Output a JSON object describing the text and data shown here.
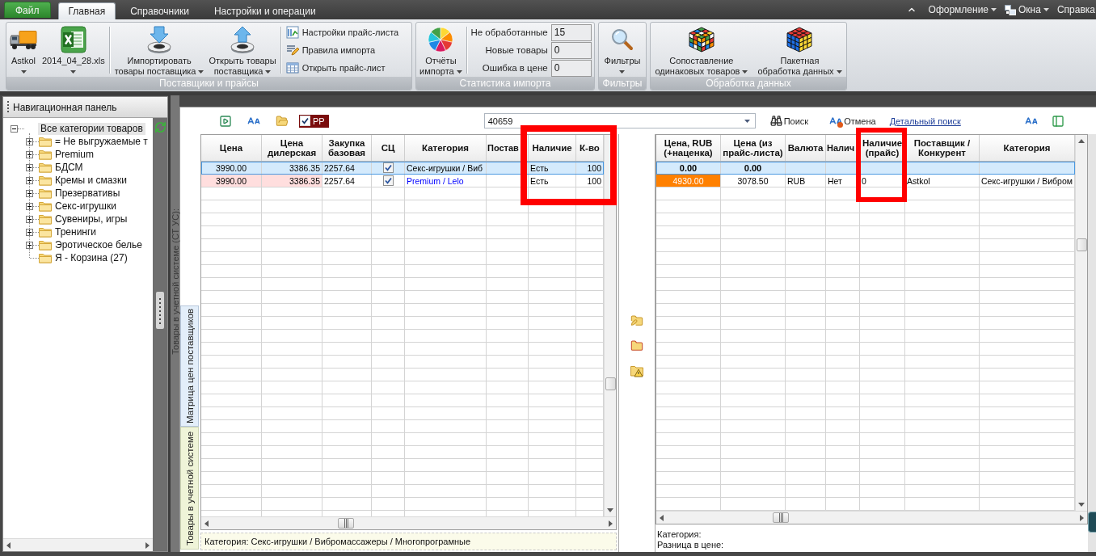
{
  "menu_bar": {
    "tabs": [
      {
        "label": "Файл",
        "kind": "file",
        "selected": false
      },
      {
        "label": "Главная",
        "kind": "tab",
        "selected": true
      },
      {
        "label": "Справочники",
        "kind": "tab",
        "selected": false
      },
      {
        "label": "Настройки и операции",
        "kind": "tab",
        "selected": false
      }
    ],
    "right_items": [
      {
        "label": "Оформление",
        "dropdown": true
      },
      {
        "label": "Окна",
        "dropdown": true
      },
      {
        "label": "Справка",
        "dropdown": false
      }
    ]
  },
  "ribbon": {
    "groups": [
      {
        "title": "Поставщики и прайсы",
        "sections": [
          {
            "kind": "large",
            "buttons": [
              {
                "lines": [
                  "Astkol"
                ],
                "dropdown": true
              },
              {
                "lines": [
                  "2014_04_28.xls"
                ],
                "dropdown": true
              }
            ]
          },
          {
            "kind": "large",
            "buttons": [
              {
                "lines": [
                  "Импортировать",
                  "товары поставщика"
                ],
                "dropdown": true
              },
              {
                "lines": [
                  "Открыть товары",
                  "поставщика"
                ],
                "dropdown": true
              }
            ]
          },
          {
            "kind": "small",
            "buttons": [
              {
                "label": "Настройки прайс-листа"
              },
              {
                "label": "Правила импорта"
              },
              {
                "label": "Открыть прайс-лист"
              }
            ]
          }
        ]
      },
      {
        "title": "Статистика импорта",
        "sections": [
          {
            "kind": "large",
            "buttons": [
              {
                "lines": [
                  "Отчёты",
                  "импорта"
                ],
                "dropdown": true
              }
            ]
          },
          {
            "kind": "stats",
            "items": [
              {
                "label": "Не обработанные",
                "value": "15"
              },
              {
                "label": "Новые товары",
                "value": "0"
              },
              {
                "label": "Ошибка в цене",
                "value": "0"
              }
            ]
          }
        ]
      },
      {
        "title": "Фильтры",
        "sections": [
          {
            "kind": "large",
            "buttons": [
              {
                "lines": [
                  "Фильтры"
                ],
                "dropdown": true
              }
            ]
          }
        ]
      },
      {
        "title": "Обработка данных",
        "sections": [
          {
            "kind": "large",
            "buttons": [
              {
                "lines": [
                  "Сопоставление",
                  "одинаковых товаров"
                ],
                "dropdown": true
              },
              {
                "lines": [
                  "Пакетная",
                  "обработка данных"
                ],
                "dropdown": true
              }
            ]
          }
        ]
      }
    ]
  },
  "navigation": {
    "title": "Навигационная панель",
    "tree": [
      {
        "label": "Все категории товаров",
        "kind": "group",
        "expanded": true,
        "selected": true,
        "children": [
          {
            "label": "= Не выгружаемые т",
            "kind": "group",
            "expanded": false,
            "selected": false
          },
          {
            "label": "Premium",
            "kind": "group",
            "expanded": false,
            "selected": false
          },
          {
            "label": "БДСМ",
            "kind": "group",
            "expanded": false,
            "selected": false
          },
          {
            "label": "Кремы и смазки",
            "kind": "group",
            "expanded": false,
            "selected": false
          },
          {
            "label": "Презервативы",
            "kind": "group",
            "expanded": false,
            "selected": false
          },
          {
            "label": "Секс-игрушки",
            "kind": "group",
            "expanded": false,
            "selected": false
          },
          {
            "label": "Сувениры, игры",
            "kind": "group",
            "expanded": false,
            "selected": false
          },
          {
            "label": "Тренинги",
            "kind": "group",
            "expanded": false,
            "selected": false
          },
          {
            "label": "Эротическое белье",
            "kind": "group",
            "expanded": false,
            "selected": false
          },
          {
            "label": "Я - Корзина (27)",
            "kind": "leaf",
            "selected": false
          }
        ]
      }
    ]
  },
  "workspace": {
    "side_caption": "Товары в учетной системе (СТ УС):",
    "vertical_tabs": [
      {
        "label": "Матрица цен поставщиков",
        "selected": true
      },
      {
        "label": "Товары в учетной системе",
        "selected": false
      }
    ],
    "toolbar": {
      "pp_checkbox": {
        "label": "PP",
        "checked": true
      },
      "search_field": {
        "value": "40659"
      },
      "buttons": [
        {
          "label": "Поиск"
        },
        {
          "label": "Отмена"
        }
      ],
      "link": "Детальный поиск"
    },
    "left_grid": {
      "columns": [
        {
          "label": "Цена",
          "framed": false
        },
        {
          "label": "Цена дилерская",
          "framed": false
        },
        {
          "label": "Закупка базовая",
          "framed": false
        },
        {
          "label": "СЦ",
          "framed": false
        },
        {
          "label": "Категория",
          "framed": false
        },
        {
          "label": "Постав",
          "framed": false
        },
        {
          "label": "Наличие",
          "framed": true
        },
        {
          "label": "К-во",
          "framed": true
        }
      ],
      "rows": [
        {
          "selected": true,
          "cells": [
            {
              "kind": "text",
              "text": "3990.00"
            },
            {
              "kind": "text",
              "text": "3386.35"
            },
            {
              "kind": "text",
              "text": "2257.64"
            },
            {
              "kind": "check",
              "checked": true
            },
            {
              "kind": "text",
              "text": "Секс-игрушки / Виб"
            },
            {
              "kind": "empty"
            },
            {
              "kind": "text",
              "text": "Есть"
            },
            {
              "kind": "text",
              "text": "100"
            }
          ]
        },
        {
          "selected": false,
          "cells": [
            {
              "kind": "filled",
              "text": "3990.00",
              "color": "#ffdede"
            },
            {
              "kind": "filled",
              "text": "3386.35",
              "color": "#ffdede"
            },
            {
              "kind": "text",
              "text": "2257.64"
            },
            {
              "kind": "check",
              "checked": true
            },
            {
              "kind": "colored_text",
              "text": "Premium / Lelo",
              "color": "#0000ff"
            },
            {
              "kind": "empty"
            },
            {
              "kind": "text",
              "text": "Есть"
            },
            {
              "kind": "text",
              "text": "100"
            }
          ]
        }
      ],
      "status": "Категория: Секс-игрушки / Вибромассажеры / Многопрограмные"
    },
    "right_grid": {
      "columns": [
        {
          "label": "Цена, RUB (+наценка)",
          "framed": false
        },
        {
          "label": "Цена (из прайс-листа)",
          "framed": false
        },
        {
          "label": "Валюта",
          "framed": false
        },
        {
          "label": "Налич",
          "framed": false
        },
        {
          "label": "Наличие (прайс)",
          "framed": true
        },
        {
          "label": "Поставщик / Конкурент",
          "framed": false
        },
        {
          "label": "Категория",
          "framed": false
        }
      ],
      "rows": [
        {
          "kind": "summary",
          "selected": true,
          "cells": [
            {
              "kind": "text",
              "text": "0.00"
            },
            {
              "kind": "text",
              "text": "0.00"
            },
            {
              "kind": "empty"
            },
            {
              "kind": "empty"
            },
            {
              "kind": "empty"
            },
            {
              "kind": "empty"
            },
            {
              "kind": "empty"
            }
          ]
        },
        {
          "kind": "data",
          "selected": false,
          "cells": [
            {
              "kind": "filled",
              "text": "4930.00",
              "color": "#ff8000"
            },
            {
              "kind": "text",
              "text": "3078.50"
            },
            {
              "kind": "text",
              "text": "RUB"
            },
            {
              "kind": "text",
              "text": "Нет"
            },
            {
              "kind": "text",
              "text": "0"
            },
            {
              "kind": "text",
              "text": "Astkol"
            },
            {
              "kind": "text",
              "text": "Секс-игрушки / Вибром"
            }
          ]
        }
      ],
      "footer": [
        "Категория:",
        "Разница в цене:"
      ]
    }
  }
}
